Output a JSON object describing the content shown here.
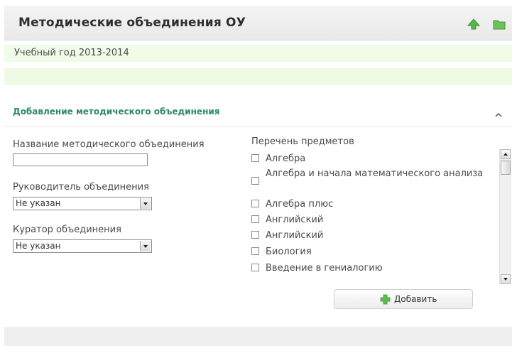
{
  "header": {
    "title": "Методические объединения ОУ",
    "icons": [
      "up-arrow-icon",
      "folder-icon"
    ]
  },
  "year": {
    "text": "Учебный год 2013-2014"
  },
  "section": {
    "title": "Добавление методического объединения",
    "toggle_icon": "chevron-up-icon"
  },
  "form": {
    "name_label": "Название методического объединения",
    "name_value": "",
    "leader_label": "Руководитель объединения",
    "leader_value": "Не указан",
    "curator_label": "Куратор объединения",
    "curator_value": "Не указан"
  },
  "subjects": {
    "label": "Перечень предметов",
    "items": [
      {
        "label": "Алгебра",
        "checked": false
      },
      {
        "label": "Алгебра и начала математического анализа",
        "checked": false
      },
      {
        "label": "Алгебра плюс",
        "checked": false
      },
      {
        "label": "Английский",
        "checked": false
      },
      {
        "label": "Английский",
        "checked": false
      },
      {
        "label": "Биология",
        "checked": false
      },
      {
        "label": "Введение в гениалогию",
        "checked": false
      }
    ]
  },
  "actions": {
    "add_label": "Добавить"
  },
  "colors": {
    "accent": "#2e8a63",
    "icon_green": "#4caf50",
    "row_bg": "#f0fbe8"
  }
}
